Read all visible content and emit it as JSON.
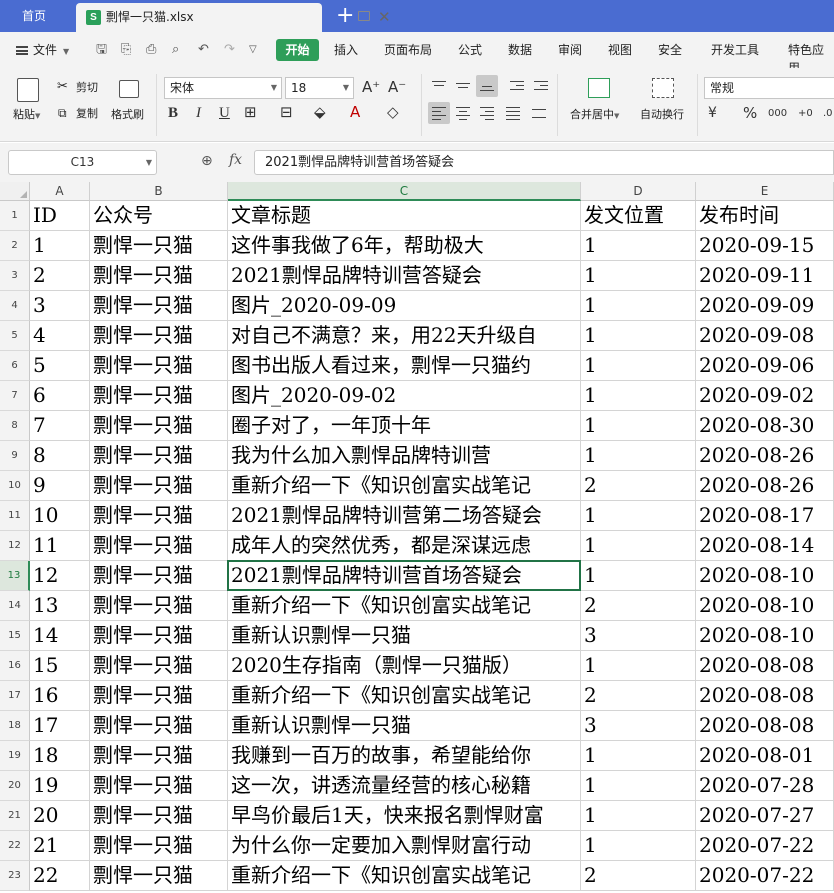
{
  "tabs": {
    "home": "首页",
    "file": "剽悍一只猫.xlsx",
    "new_tab": "+"
  },
  "menu": {
    "file": "文件",
    "items": [
      "开始",
      "插入",
      "页面布局",
      "公式",
      "数据",
      "审阅",
      "视图",
      "安全",
      "开发工具",
      "特色应用"
    ]
  },
  "ribbon": {
    "paste": "粘贴",
    "cut": "剪切",
    "copy": "复制",
    "format_painter": "格式刷",
    "font_name": "宋体",
    "font_size": "18",
    "merge_center": "合并居中",
    "wrap_text": "自动换行",
    "number_format": "常规"
  },
  "formula_bar": {
    "cell_ref": "C13",
    "fx": "fx",
    "value": "2021剽悍品牌特训营首场答疑会"
  },
  "grid": {
    "columns": [
      "A",
      "B",
      "C",
      "D",
      "E"
    ],
    "active_column": "C",
    "active_row": "13",
    "rows": [
      {
        "num": "1",
        "cells": [
          "ID",
          "公众号",
          "文章标题",
          "发文位置",
          "发布时间"
        ]
      },
      {
        "num": "2",
        "cells": [
          "1",
          "剽悍一只猫",
          "这件事我做了6年，帮助极大",
          "1",
          "2020-09-15"
        ]
      },
      {
        "num": "3",
        "cells": [
          "2",
          "剽悍一只猫",
          "2021剽悍品牌特训营答疑会",
          "1",
          "2020-09-11"
        ]
      },
      {
        "num": "4",
        "cells": [
          "3",
          "剽悍一只猫",
          "图片_2020-09-09",
          "1",
          "2020-09-09"
        ]
      },
      {
        "num": "5",
        "cells": [
          "4",
          "剽悍一只猫",
          "对自己不满意？来，用22天升级自",
          "1",
          "2020-09-08"
        ]
      },
      {
        "num": "6",
        "cells": [
          "5",
          "剽悍一只猫",
          "图书出版人看过来，剽悍一只猫约",
          "1",
          "2020-09-06"
        ]
      },
      {
        "num": "7",
        "cells": [
          "6",
          "剽悍一只猫",
          "图片_2020-09-02",
          "1",
          "2020-09-02"
        ]
      },
      {
        "num": "8",
        "cells": [
          "7",
          "剽悍一只猫",
          "圈子对了，一年顶十年",
          "1",
          "2020-08-30"
        ]
      },
      {
        "num": "9",
        "cells": [
          "8",
          "剽悍一只猫",
          "我为什么加入剽悍品牌特训营",
          "1",
          "2020-08-26"
        ]
      },
      {
        "num": "10",
        "cells": [
          "9",
          "剽悍一只猫",
          "重新介绍一下《知识创富实战笔记",
          "2",
          "2020-08-26"
        ]
      },
      {
        "num": "11",
        "cells": [
          "10",
          "剽悍一只猫",
          "2021剽悍品牌特训营第二场答疑会",
          "1",
          "2020-08-17"
        ]
      },
      {
        "num": "12",
        "cells": [
          "11",
          "剽悍一只猫",
          "成年人的突然优秀，都是深谋远虑",
          "1",
          "2020-08-14"
        ]
      },
      {
        "num": "13",
        "cells": [
          "12",
          "剽悍一只猫",
          "2021剽悍品牌特训营首场答疑会",
          "1",
          "2020-08-10"
        ]
      },
      {
        "num": "14",
        "cells": [
          "13",
          "剽悍一只猫",
          "重新介绍一下《知识创富实战笔记",
          "2",
          "2020-08-10"
        ]
      },
      {
        "num": "15",
        "cells": [
          "14",
          "剽悍一只猫",
          "重新认识剽悍一只猫",
          "3",
          "2020-08-10"
        ]
      },
      {
        "num": "16",
        "cells": [
          "15",
          "剽悍一只猫",
          "2020生存指南（剽悍一只猫版）",
          "1",
          "2020-08-08"
        ]
      },
      {
        "num": "17",
        "cells": [
          "16",
          "剽悍一只猫",
          "重新介绍一下《知识创富实战笔记",
          "2",
          "2020-08-08"
        ]
      },
      {
        "num": "18",
        "cells": [
          "17",
          "剽悍一只猫",
          "重新认识剽悍一只猫",
          "3",
          "2020-08-08"
        ]
      },
      {
        "num": "19",
        "cells": [
          "18",
          "剽悍一只猫",
          "我赚到一百万的故事，希望能给你",
          "1",
          "2020-08-01"
        ]
      },
      {
        "num": "20",
        "cells": [
          "19",
          "剽悍一只猫",
          "这一次，讲透流量经营的核心秘籍",
          "1",
          "2020-07-28"
        ]
      },
      {
        "num": "21",
        "cells": [
          "20",
          "剽悍一只猫",
          "早鸟价最后1天，快来报名剽悍财富",
          "1",
          "2020-07-27"
        ]
      },
      {
        "num": "22",
        "cells": [
          "21",
          "剽悍一只猫",
          "为什么你一定要加入剽悍财富行动",
          "1",
          "2020-07-22"
        ]
      },
      {
        "num": "23",
        "cells": [
          "22",
          "剽悍一只猫",
          "重新介绍一下《知识创富实战笔记",
          "2",
          "2020-07-22"
        ]
      }
    ]
  }
}
